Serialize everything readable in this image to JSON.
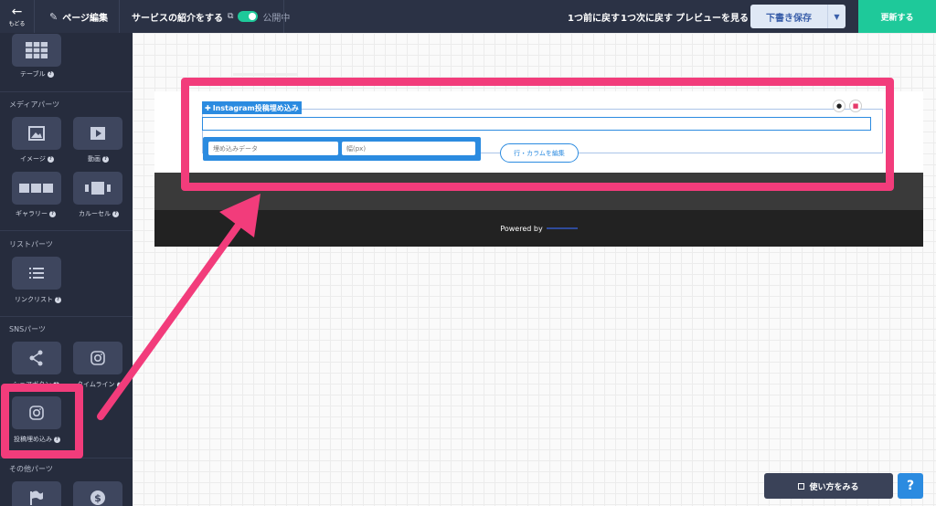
{
  "topbar": {
    "back_label": "もどる",
    "page_edit": "ページ編集",
    "service_title": "サービスの紹介をする",
    "public_status": "公開中",
    "undo": "1つ前に戻す",
    "redo": "1つ次に戻す",
    "preview": "プレビューを見る",
    "save_draft": "下書き保存",
    "update": "更新する"
  },
  "sidebar": {
    "table_label": "テーブル",
    "media_section": "メディアパーツ",
    "image_label": "イメージ",
    "video_label": "動画",
    "gallery_label": "ギャラリー",
    "carousel_label": "カルーセル",
    "list_section": "リストパーツ",
    "linklist_label": "リンクリスト",
    "sns_section": "SNSパーツ",
    "share_label": "シェアボタン",
    "timeline_label": "タイムライン",
    "embed_label": "投稿埋め込み",
    "other_section": "その他パーツ"
  },
  "canvas": {
    "block_label": "Instagram投稿埋め込み",
    "embed_data_placeholder": "埋め込みデータ",
    "width_placeholder": "幅(px)",
    "rowcol_button": "行・カラムを編集",
    "powered_by": "Powered by"
  },
  "bottom": {
    "howto": "使い方をみる",
    "help": "?"
  },
  "colors": {
    "accent": "#1ec99a",
    "highlight": "#f23c7b",
    "blue": "#2b8be0",
    "sidebar": "#262c3d"
  }
}
